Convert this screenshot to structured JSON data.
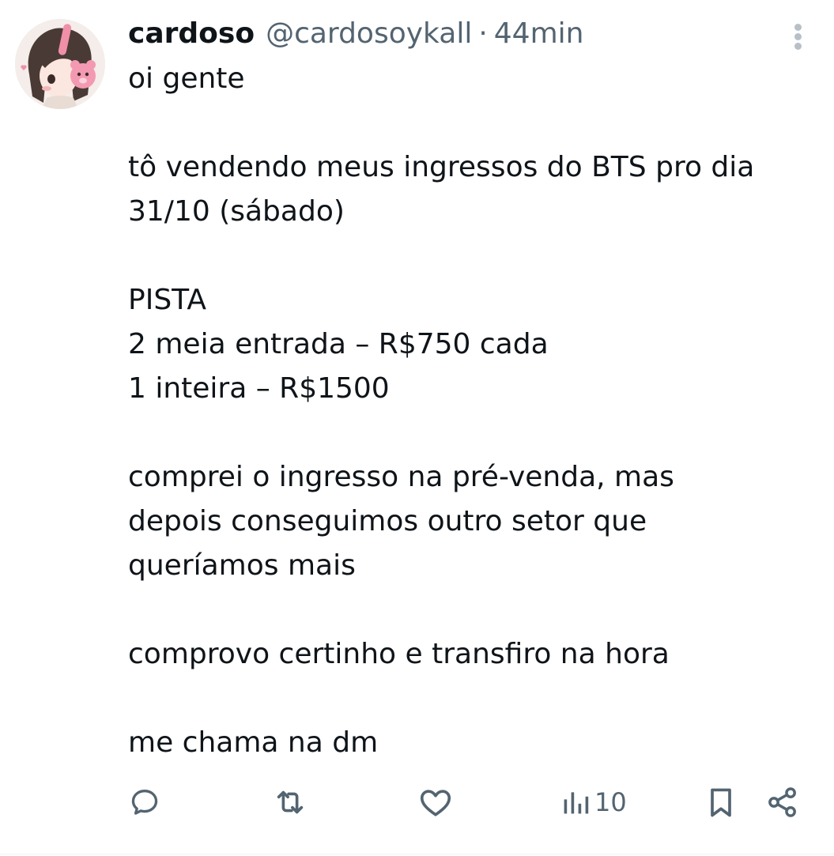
{
  "tweet": {
    "author": {
      "display_name": "cardoso",
      "handle": "@cardosoykall",
      "avatar_icon": "avatar-icon"
    },
    "separator": "·",
    "time": "44min",
    "more_icon": "more-vertical-icon",
    "text_lines": [
      "oi gente",
      "",
      "tô vendendo meus ingressos do BTS pro dia",
      "31/10 (sábado)",
      "",
      "PISTA",
      "2 meia entrada – R$750 cada",
      "1 inteira – R$1500",
      "",
      "comprei o ingresso na pré-venda, mas",
      "depois conseguimos outro setor que",
      "queríamos mais",
      "",
      "comprovo certinho e transfiro na hora",
      "",
      "me chama na dm"
    ],
    "actions": {
      "reply_icon": "reply-icon",
      "retweet_icon": "retweet-icon",
      "like_icon": "heart-icon",
      "views_icon": "views-chart-icon",
      "views_count": "10",
      "bookmark_icon": "bookmark-icon",
      "share_icon": "share-icon"
    },
    "colors": {
      "text": "#0f1419",
      "secondary": "#536471",
      "icon": "#536471"
    }
  }
}
